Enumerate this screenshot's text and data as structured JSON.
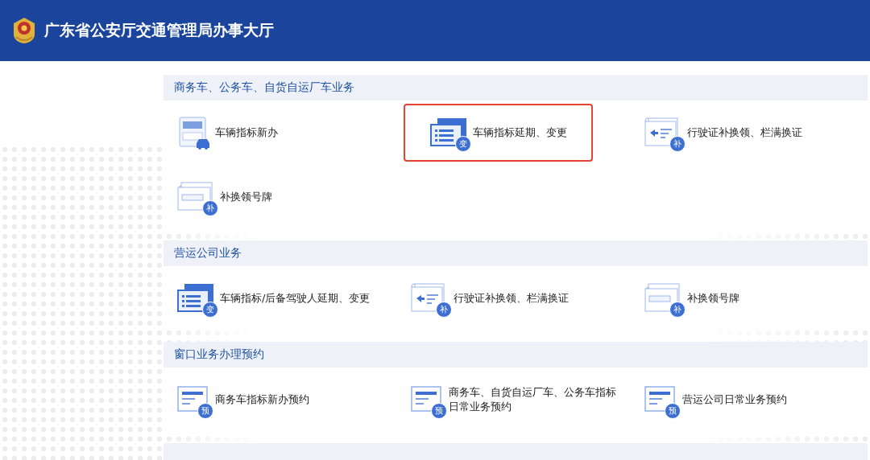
{
  "header": {
    "title": "广东省公安厅交通管理局办事大厅"
  },
  "sections": [
    {
      "title": "商务车、公务车、自货自运厂车业务",
      "items": [
        {
          "kind": "plate-new",
          "label": "车辆指标新办",
          "selected": false
        },
        {
          "kind": "change",
          "badge": "变",
          "label": "车辆指标延期、变更",
          "selected": true
        },
        {
          "kind": "license",
          "badge": "补",
          "label": "行驶证补换领、栏满换证",
          "selected": false
        },
        {
          "kind": "plate",
          "badge": "补",
          "label": "补换领号牌",
          "selected": false
        }
      ]
    },
    {
      "title": "营运公司业务",
      "items": [
        {
          "kind": "change",
          "badge": "变",
          "label": "车辆指标/后备驾驶人延期、变更",
          "selected": false
        },
        {
          "kind": "license",
          "badge": "补",
          "label": "行驶证补换领、栏满换证",
          "selected": false
        },
        {
          "kind": "plate",
          "badge": "补",
          "label": "补换领号牌",
          "selected": false
        }
      ]
    },
    {
      "title": "窗口业务办理预约",
      "items": [
        {
          "kind": "appointment",
          "badge": "预",
          "label": "商务车指标新办预约",
          "selected": false
        },
        {
          "kind": "appointment",
          "badge": "预",
          "label": "商务车、自货自运厂车、公务车指标日常业务预约",
          "selected": false
        },
        {
          "kind": "appointment",
          "badge": "预",
          "label": "营运公司日常业务预约",
          "selected": false
        }
      ]
    }
  ]
}
